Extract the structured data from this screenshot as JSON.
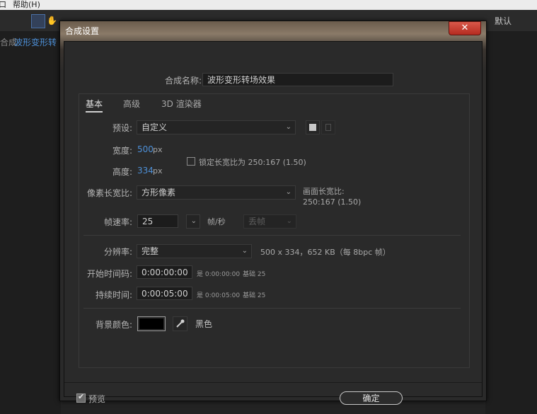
{
  "app": {
    "menu_help": "帮助(H)",
    "menu_left_fragment": "口",
    "workspace_default": "默认",
    "panel_tab_prefix": "合成",
    "panel_tab_name": "波形变形转"
  },
  "dialog": {
    "title": "合成设置",
    "close_glyph": "✕",
    "comp_name_label": "合成名称:",
    "comp_name_value": "波形变形转场效果",
    "tabs": [
      "基本",
      "高级",
      "3D 渲染器"
    ],
    "preset": {
      "label": "预设:",
      "value": "自定义"
    },
    "width": {
      "label": "宽度:",
      "value": "500",
      "unit": "px"
    },
    "height": {
      "label": "高度:",
      "value": "334",
      "unit": "px"
    },
    "lock_aspect": {
      "label": "锁定长宽比为 250:167 (1.50)",
      "checked": false
    },
    "pixel_aspect": {
      "label": "像素长宽比:",
      "value": "方形像素"
    },
    "frame_aspect": {
      "label": "画面长宽比:",
      "value": "250:167 (1.50)"
    },
    "frame_rate": {
      "label": "帧速率:",
      "value": "25",
      "unit": "帧/秒",
      "drop_frame": "丢帧"
    },
    "resolution": {
      "label": "分辨率:",
      "value": "完整",
      "info": "500 x 334，652 KB（每 8bpc 帧）"
    },
    "start_timecode": {
      "label": "开始时间码:",
      "value": "0:00:00:00",
      "note1": "是 0:00:00:00",
      "note2": "基础 25"
    },
    "duration": {
      "label": "持续时间:",
      "value": "0:00:05:00",
      "note1": "是 0:00:05:00",
      "note2": "基础 25"
    },
    "background": {
      "label": "背景颜色:",
      "color": "#000000",
      "name": "黑色"
    },
    "preview": {
      "label": "预览",
      "checked": true
    },
    "ok_label": "确定"
  },
  "colors": {
    "accent_value": "#4d90d8",
    "close_red": "#c63a2e"
  }
}
